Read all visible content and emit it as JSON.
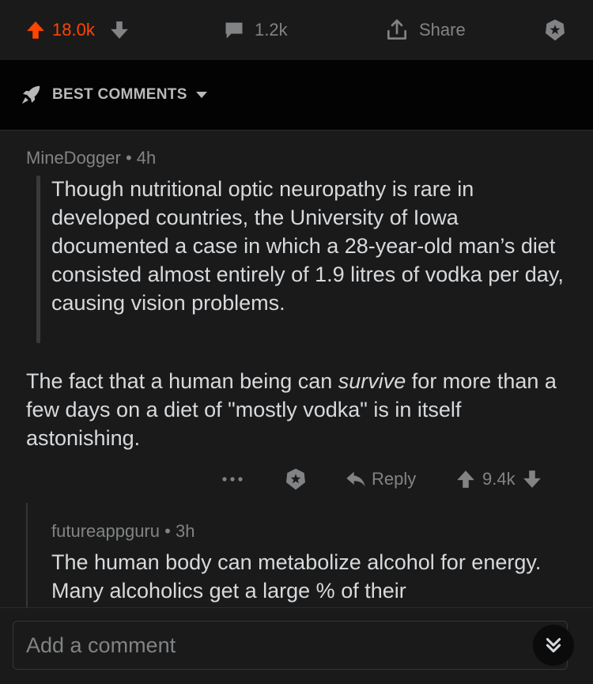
{
  "post_actions": {
    "upvote_count": "18.0k",
    "comment_count": "1.2k",
    "share_label": "Share"
  },
  "sort": {
    "label": "BEST COMMENTS"
  },
  "comments": [
    {
      "author": "MineDogger",
      "separator": "•",
      "age": "4h",
      "quote": "Though nutritional optic neuropathy is rare in developed countries, the University of Iowa documented a case in which a 28-year-old man’s diet consisted almost entirely of 1.9 litres of vodka per day, causing vision problems.",
      "text_before": "The fact that a human being can ",
      "text_italic": "survive",
      "text_after": " for more than a few days on a diet of \"mostly vodka\" is in itself astonishing.",
      "reply_label": "Reply",
      "score": "9.4k"
    },
    {
      "author": "futureappguru",
      "separator": "•",
      "age": "3h",
      "text": "The human body can metabolize alcohol for energy. Many alcoholics get a large % of their"
    }
  ],
  "composer": {
    "placeholder": "Add a comment"
  },
  "colors": {
    "upvote": "#ff4500",
    "muted": "#818384",
    "text": "#d7dadc",
    "background": "#1a1a1b",
    "sort_background": "#030303"
  }
}
